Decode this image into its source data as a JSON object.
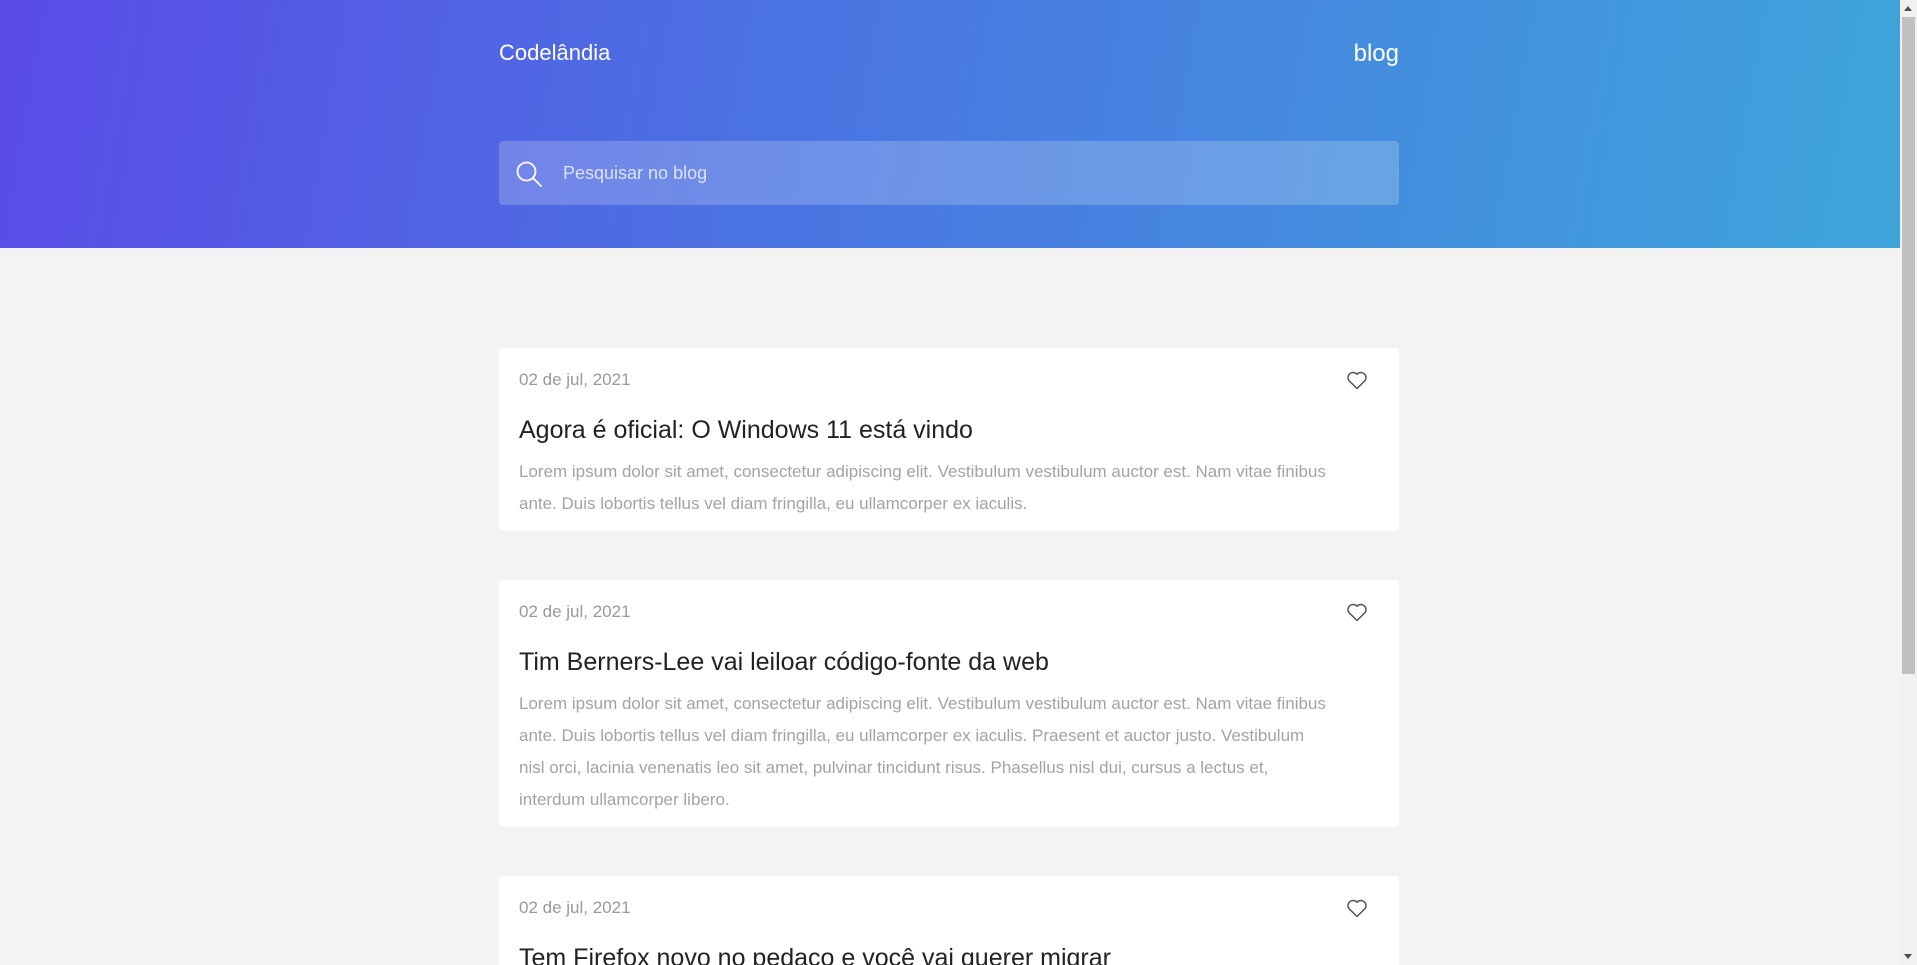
{
  "header": {
    "brand": "Codelândia",
    "nav_blog": "blog",
    "search": {
      "placeholder": "Pesquisar no blog",
      "icon": "search-icon"
    }
  },
  "posts": [
    {
      "date": "02 de jul, 2021",
      "title": "Agora é oficial: O Windows 11 está vindo",
      "excerpt": "Lorem ipsum dolor sit amet, consectetur adipiscing elit. Vestibulum vestibulum auctor est. Nam vitae finibus ante. Duis lobortis tellus vel diam fringilla, eu ullamcorper ex iaculis.",
      "like_icon": "heart-icon"
    },
    {
      "date": "02 de jul, 2021",
      "title": "Tim Berners-Lee vai leiloar código-fonte da web",
      "excerpt": "Lorem ipsum dolor sit amet, consectetur adipiscing elit. Vestibulum vestibulum auctor est. Nam vitae finibus ante. Duis lobortis tellus vel diam fringilla, eu ullamcorper ex iaculis. Praesent et auctor justo. Vestibulum nisl orci, lacinia venenatis leo sit amet, pulvinar tincidunt risus. Phasellus nisl dui, cursus a lectus et, interdum ullamcorper libero.",
      "like_icon": "heart-icon"
    },
    {
      "date": "02 de jul, 2021",
      "title": "Tem Firefox novo no pedaço e você vai querer migrar",
      "like_icon": "heart-icon"
    }
  ],
  "colors": {
    "header_gradient_start": "#5a4be7",
    "header_gradient_end": "#3ea5db",
    "page_background": "#f2f3f2",
    "card_background": "#ffffff"
  }
}
